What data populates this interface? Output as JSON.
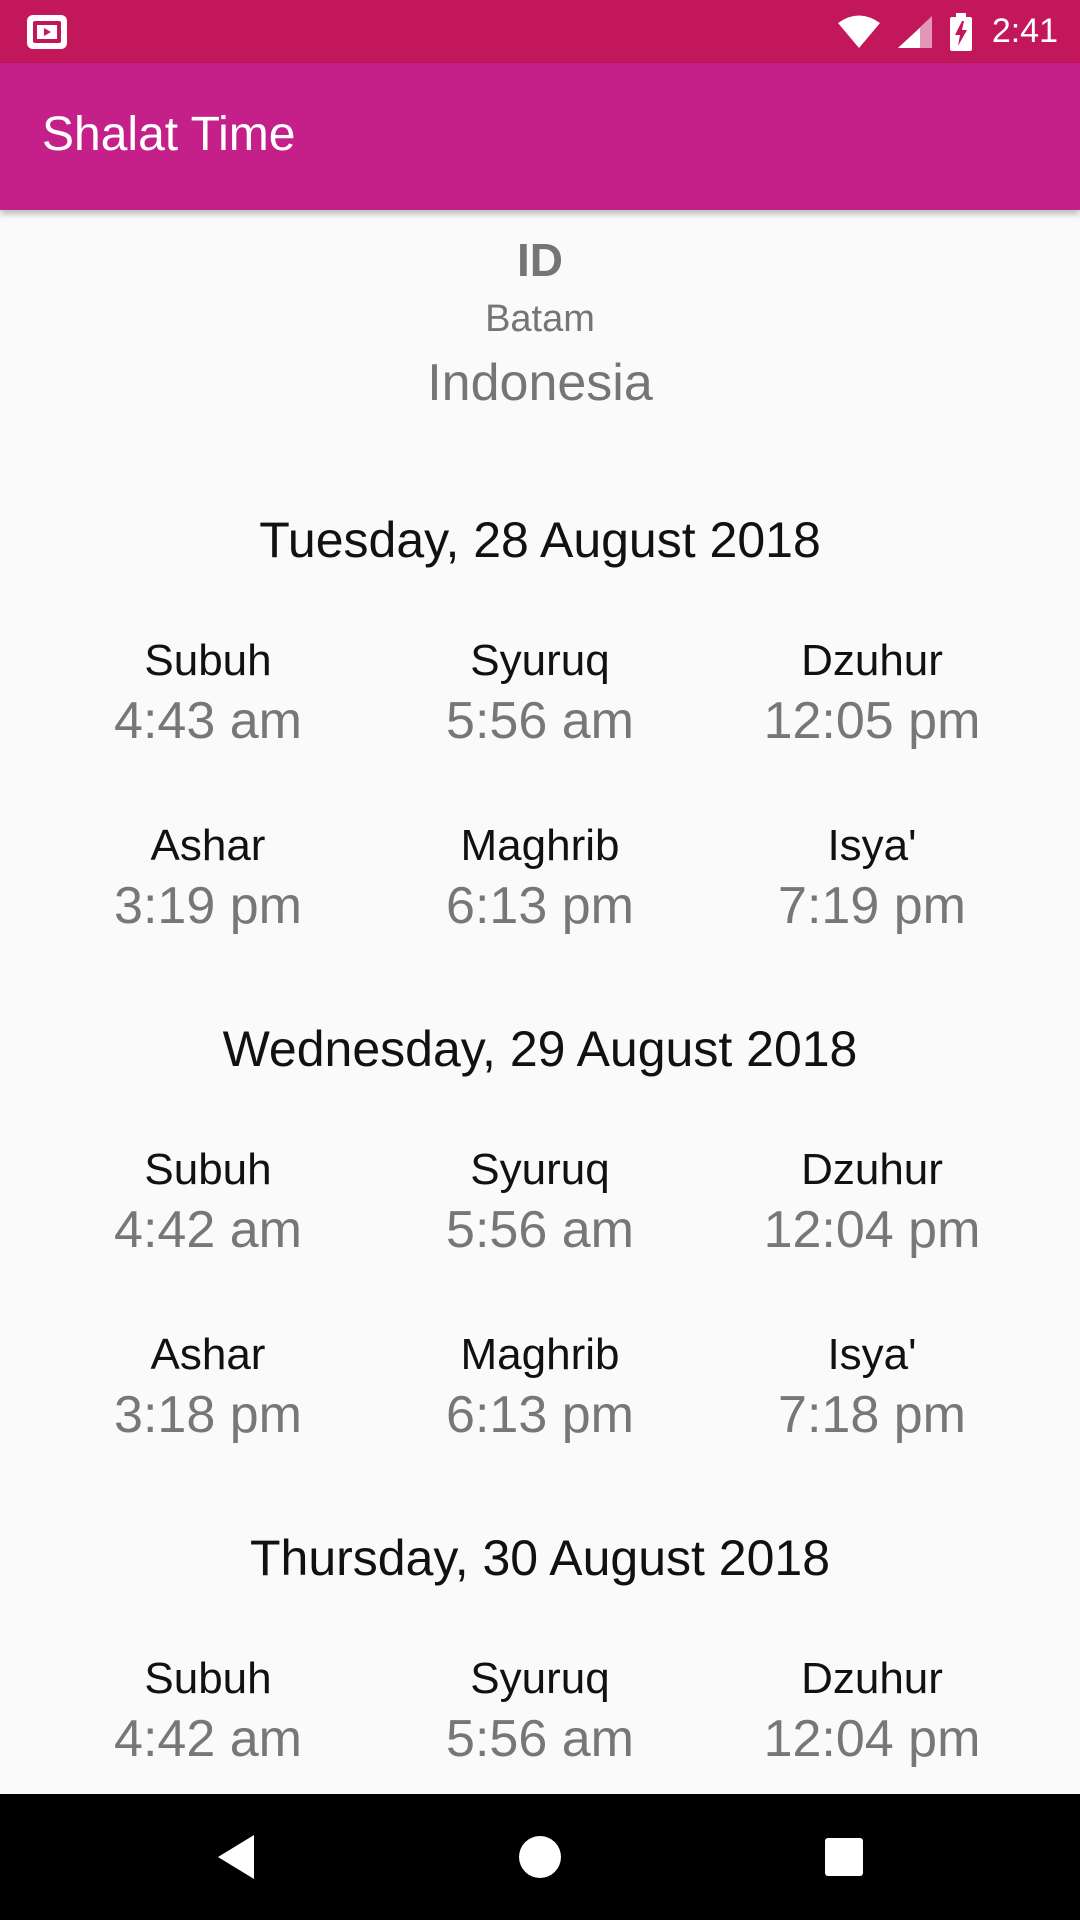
{
  "status_bar": {
    "time": "2:41",
    "icons": [
      "app-notification-icon",
      "wifi-icon",
      "cell-signal-icon",
      "battery-charging-icon"
    ],
    "background": "#c2185b"
  },
  "app_bar": {
    "title": "Shalat Time",
    "background": "#c51f8a"
  },
  "location": {
    "code": "ID",
    "city": "Batam",
    "country": "Indonesia"
  },
  "days": [
    {
      "date": "Tuesday, 28 August 2018",
      "prayers": [
        {
          "name": "Subuh",
          "time": "4:43 am"
        },
        {
          "name": "Syuruq",
          "time": "5:56 am"
        },
        {
          "name": "Dzuhur",
          "time": "12:05 pm"
        },
        {
          "name": "Ashar",
          "time": "3:19 pm"
        },
        {
          "name": "Maghrib",
          "time": "6:13 pm"
        },
        {
          "name": "Isya'",
          "time": "7:19 pm"
        }
      ]
    },
    {
      "date": "Wednesday, 29 August 2018",
      "prayers": [
        {
          "name": "Subuh",
          "time": "4:42 am"
        },
        {
          "name": "Syuruq",
          "time": "5:56 am"
        },
        {
          "name": "Dzuhur",
          "time": "12:04 pm"
        },
        {
          "name": "Ashar",
          "time": "3:18 pm"
        },
        {
          "name": "Maghrib",
          "time": "6:13 pm"
        },
        {
          "name": "Isya'",
          "time": "7:18 pm"
        }
      ]
    },
    {
      "date": "Thursday, 30 August 2018",
      "prayers": [
        {
          "name": "Subuh",
          "time": "4:42 am"
        },
        {
          "name": "Syuruq",
          "time": "5:56 am"
        },
        {
          "name": "Dzuhur",
          "time": "12:04 pm"
        }
      ]
    }
  ],
  "nav_bar": {
    "buttons": [
      "back-icon",
      "home-icon",
      "recents-icon"
    ]
  }
}
